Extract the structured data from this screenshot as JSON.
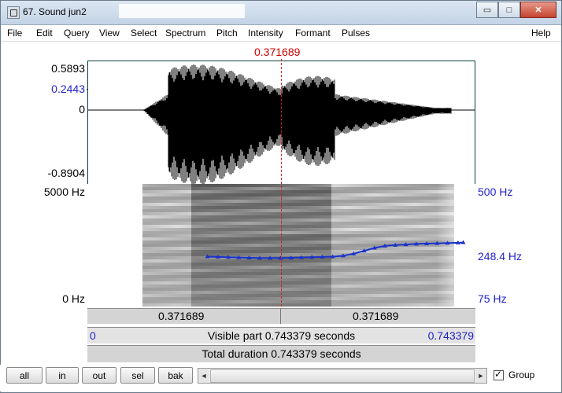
{
  "window": {
    "title": "67. Sound jun2",
    "minimize": "▭",
    "maximize": "□",
    "close": "✕"
  },
  "menu": [
    "File",
    "Edit",
    "Query",
    "View",
    "Select",
    "Spectrum",
    "Pitch",
    "Intensity",
    "Formant",
    "Pulses",
    "Help"
  ],
  "cursor_time": "0.371689",
  "waveform": {
    "ymax": "0.5893",
    "ycursor": "0.2443",
    "yzero": "0",
    "ymin": "-0.8904",
    "color": "#000000"
  },
  "spectrogram": {
    "fmax": "5000 Hz",
    "fmin": "0 Hz",
    "pitch_max": "500 Hz",
    "pitch_cursor": "248.4 Hz",
    "pitch_min": "75 Hz",
    "pitch_color": "#1a33cc"
  },
  "time_bar": {
    "left_segment": "0.371689",
    "right_segment": "0.371689",
    "visible_start": "0",
    "visible_label": "Visible part 0.743379 seconds",
    "visible_end": "0.743379",
    "total_label": "Total duration 0.743379 seconds"
  },
  "buttons": {
    "all": "all",
    "in": "in",
    "out": "out",
    "sel": "sel",
    "bak": "bak"
  },
  "scroll": {
    "left_arrow": "◄",
    "right_arrow": "►"
  },
  "group_label": "Group",
  "chart_data": {
    "type": "line",
    "title": "",
    "xlabel": "",
    "ylabel": "",
    "xlim": [
      0,
      0.743379
    ],
    "ylim": [
      75,
      500
    ],
    "series": [
      {
        "x": [
          0.23,
          0.25,
          0.27,
          0.29,
          0.31,
          0.33,
          0.35,
          0.37,
          0.39,
          0.41,
          0.43,
          0.45,
          0.47,
          0.49,
          0.51,
          0.53,
          0.55,
          0.57,
          0.59,
          0.61,
          0.63,
          0.65,
          0.67,
          0.69,
          0.71,
          0.72
        ],
        "values": [
          248,
          247,
          246,
          245,
          244,
          243,
          243,
          243,
          244,
          245,
          246,
          247,
          248,
          251,
          258,
          268,
          278,
          285,
          288,
          290,
          292,
          293,
          294,
          295,
          296,
          297
        ]
      }
    ]
  }
}
